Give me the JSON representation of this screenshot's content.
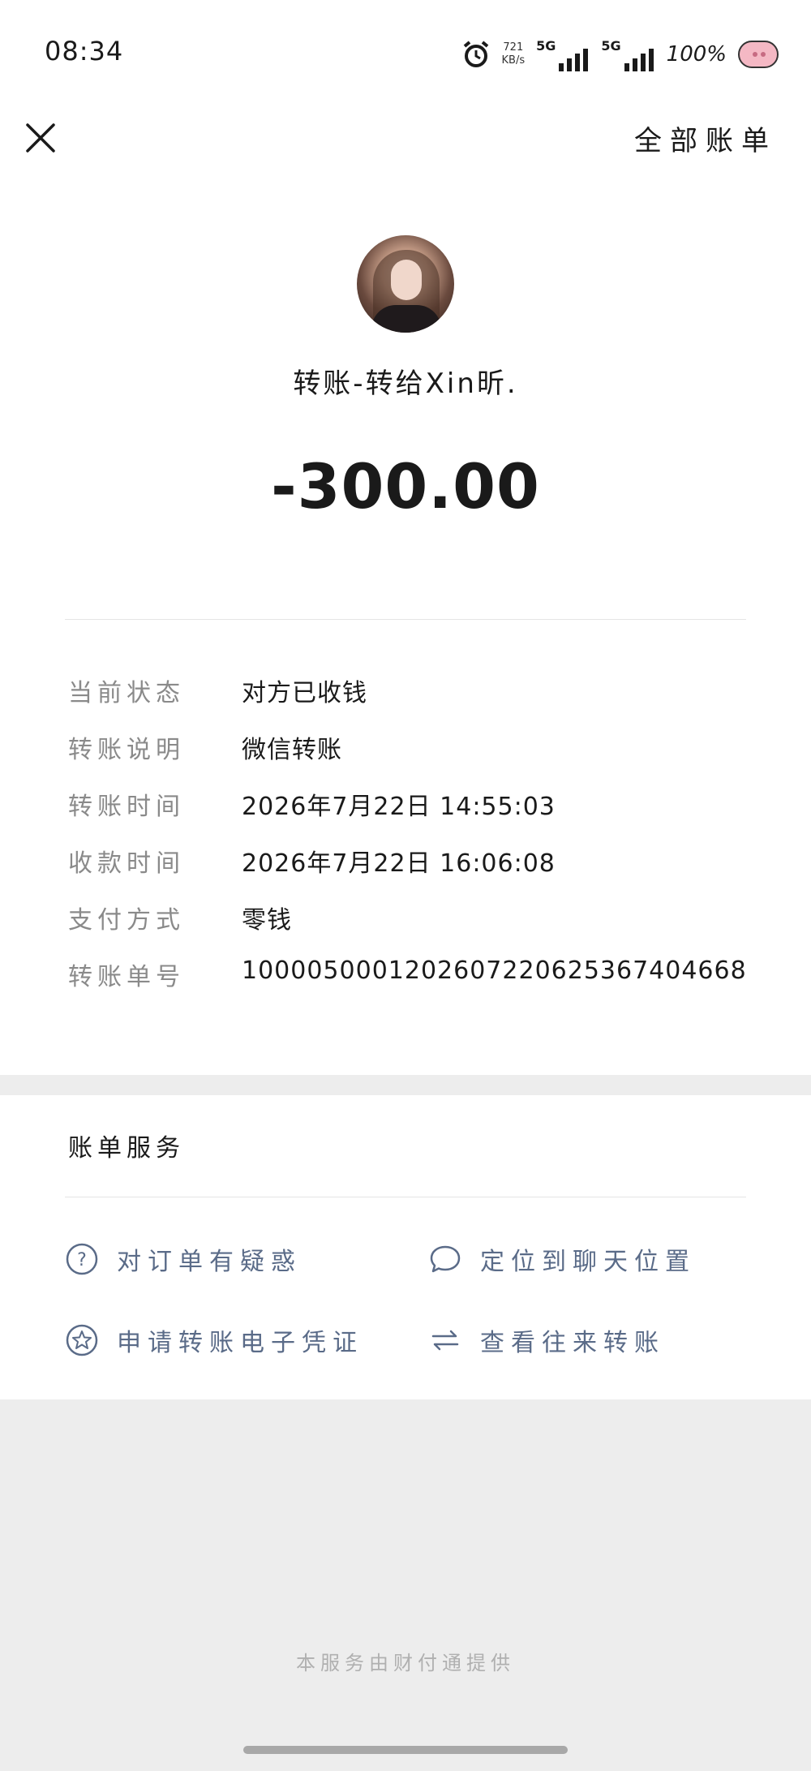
{
  "status_bar": {
    "time": "08:34",
    "net_speed_value": "721",
    "net_speed_unit": "KB/s",
    "signal_1_label": "5G",
    "signal_2_label": "5G",
    "battery": "100%"
  },
  "nav": {
    "close_icon": "close-icon",
    "all_bills_label": "全部账单"
  },
  "transaction": {
    "title": "转账-转给Xin昕.",
    "amount": "-300.00"
  },
  "details": [
    {
      "label": "当前状态",
      "value": "对方已收钱"
    },
    {
      "label": "转账说明",
      "value": "微信转账"
    },
    {
      "label": "转账时间",
      "value": "2026年7月22日 14:55:03"
    },
    {
      "label": "收款时间",
      "value": "2026年7月22日 16:06:08"
    },
    {
      "label": "支付方式",
      "value": "零钱"
    },
    {
      "label": "转账单号",
      "value": "1000050001202607220625367404668"
    }
  ],
  "services": {
    "title": "账单服务",
    "items": [
      {
        "label": "对订单有疑惑",
        "icon": "question-circle-icon"
      },
      {
        "label": "定位到聊天位置",
        "icon": "chat-bubble-icon"
      },
      {
        "label": "申请转账电子凭证",
        "icon": "star-circle-icon"
      },
      {
        "label": "查看往来转账",
        "icon": "exchange-arrows-icon"
      }
    ]
  },
  "footer": {
    "note": "本服务由财付通提供"
  },
  "colors": {
    "page_bg": "#ededed",
    "card_bg": "#ffffff",
    "service_text": "#5a6b88",
    "label_text": "#8a8a8a"
  }
}
